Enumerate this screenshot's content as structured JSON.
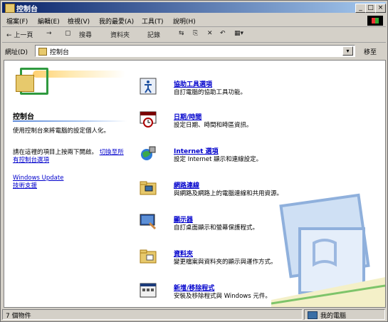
{
  "window": {
    "title": "控制台",
    "min_label": "_",
    "max_label": "□",
    "close_label": "×"
  },
  "menu": [
    "檔案(F)",
    "編輯(E)",
    "檢視(V)",
    "我的最愛(A)",
    "工具(T)",
    "說明(H)"
  ],
  "toolbar": {
    "back_label": "← 上一頁",
    "forward_label": "→",
    "up_label": "▢",
    "search_label": "搜尋",
    "folders_label": "資料夾",
    "history_label": "記錄",
    "move_label": "⇆",
    "copy_label": "⎘",
    "delete_label": "✕",
    "undo_label": "↶",
    "views_label": "▦▾"
  },
  "address": {
    "label": "網址(D)",
    "value": "控制台",
    "go_label": "移至"
  },
  "left_pane": {
    "title": "控制台",
    "desc": "使用控制台來將電腦的設定個人化。",
    "desc2_prefix": "請在這裡的項目上按兩下開啟。",
    "desc2_link": "切換至所有控制台選項",
    "link1": "Windows Update",
    "link2": "技術支援"
  },
  "items": [
    {
      "name": "協助工具選項",
      "desc": "自訂電腦的協助工具功能。",
      "icon": "accessibility-icon"
    },
    {
      "name": "日期/時間",
      "desc": "設定日期、時間和時區資訊。",
      "icon": "datetime-icon"
    },
    {
      "name": "Internet 選項",
      "desc": "設定 Internet 顯示和連線設定。",
      "icon": "internet-options-icon"
    },
    {
      "name": "網路連線",
      "desc": "與網路及網路上的電腦連線和共用資源。",
      "icon": "network-icon"
    },
    {
      "name": "顯示器",
      "desc": "自訂桌面顯示和螢幕保護程式。",
      "icon": "display-icon"
    },
    {
      "name": "資料夾",
      "desc": "變更檔案與資料夾的顯示與運作方式。",
      "icon": "folder-options-icon"
    },
    {
      "name": "新增/移除程式",
      "desc": "安裝及移除程式與 Windows 元件。",
      "icon": "add-remove-icon"
    }
  ],
  "status": {
    "left": "7 個物件",
    "right": "我的電腦"
  },
  "colors": {
    "title_start": "#0a246a",
    "title_end": "#a6caf0",
    "link": "#0000cc"
  }
}
